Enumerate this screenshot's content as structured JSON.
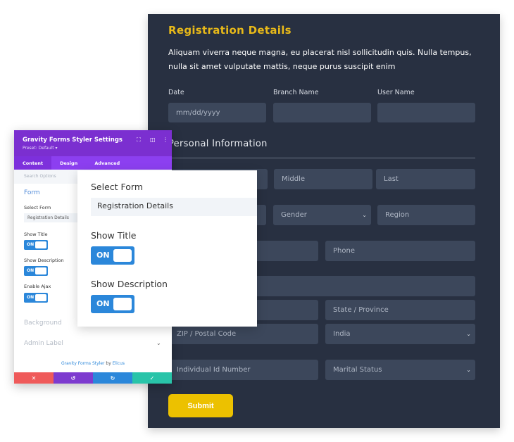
{
  "form": {
    "title": "Registration Details",
    "description": "Aliquam viverra neque magna, eu placerat nisl sollicitudin quis. Nulla tempus, nulla sit amet vulputate mattis, neque purus suscipit enim",
    "labels": {
      "date": "Date",
      "branch": "Branch Name",
      "user": "User Name"
    },
    "date_placeholder": "mm/dd/yyyy",
    "section": "Personal Information",
    "placeholders": {
      "middle": "Middle",
      "last": "Last",
      "gender": "Gender",
      "region": "Region",
      "phone": "Phone",
      "state": "State / Province",
      "zip": "ZIP / Postal Code",
      "country": "India",
      "id": "Individual Id Number",
      "marital": "Marital Status"
    },
    "submit": "Submit",
    "colors": {
      "background": "#283041",
      "field": "#3c475b",
      "accent": "#e8b919",
      "button": "#ecc100"
    }
  },
  "panel": {
    "title": "Gravity Forms Styler Settings",
    "preset": "Preset: Default ▾",
    "tabs": [
      "Content",
      "Design",
      "Advanced"
    ],
    "search": "Search Options",
    "section": "Form",
    "select_form_label": "Select Form",
    "select_form_value": "Registration Details",
    "show_title": "Show Title",
    "show_description": "Show Description",
    "enable_ajax": "Enable Ajax",
    "toggle_on": "ON",
    "background": "Background",
    "admin_label": "Admin Label",
    "footer_link": "Gravity Forms Styler",
    "footer_by": " by ",
    "footer_author": "Elicus",
    "colors": {
      "header": "#7b2fd0",
      "toggle": "#2b87da",
      "cancel": "#ef5a5a",
      "undo": "#7d3bcf",
      "redo": "#2b87da",
      "save": "#29c4a9"
    }
  },
  "popup": {
    "select_form_label": "Select Form",
    "select_form_value": "Registration Details",
    "show_title": "Show Title",
    "show_description": "Show Description",
    "toggle_on": "ON"
  }
}
